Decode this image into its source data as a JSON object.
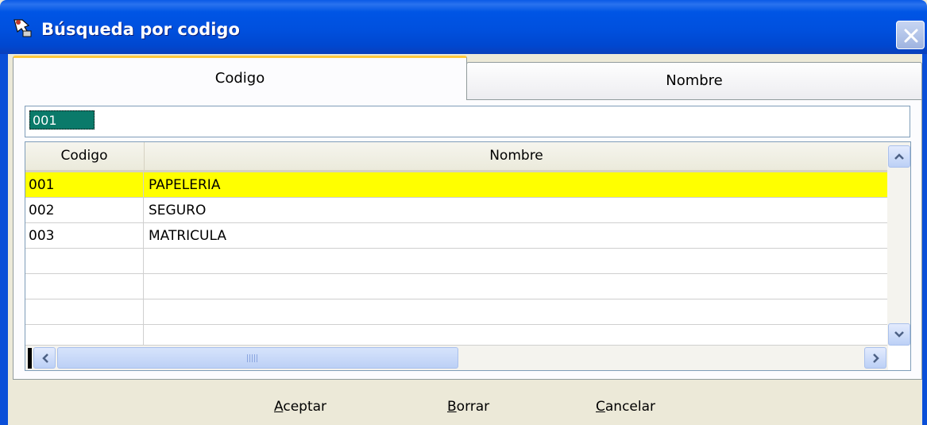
{
  "window": {
    "title": "Búsqueda por codigo"
  },
  "tabs": [
    {
      "label": "Codigo",
      "active": true
    },
    {
      "label": "Nombre",
      "active": false
    }
  ],
  "search": {
    "value": "001"
  },
  "grid": {
    "columns": [
      "Codigo",
      "Nombre"
    ],
    "rows": [
      {
        "codigo": "001",
        "nombre": "PAPELERIA",
        "selected": true
      },
      {
        "codigo": "002",
        "nombre": "SEGURO",
        "selected": false
      },
      {
        "codigo": "003",
        "nombre": "MATRICULA",
        "selected": false
      },
      {
        "codigo": "",
        "nombre": "",
        "selected": false
      },
      {
        "codigo": "",
        "nombre": "",
        "selected": false
      },
      {
        "codigo": "",
        "nombre": "",
        "selected": false
      },
      {
        "codigo": "",
        "nombre": "",
        "selected": false
      }
    ]
  },
  "buttons": {
    "accept": {
      "mnemonic": "A",
      "rest": "ceptar"
    },
    "clear": {
      "mnemonic": "B",
      "rest": "orrar"
    },
    "cancel": {
      "mnemonic": "C",
      "rest": "ancelar"
    }
  },
  "colors": {
    "titlebar": "#0055e5",
    "selected_row": "#ffff00",
    "code_highlight": "#0a7a6a",
    "active_tab_accent": "#ffc83c"
  },
  "icons": {
    "title": "search-pointer-icon",
    "close": "close-icon",
    "scroll_up": "chevron-up-icon",
    "scroll_down": "chevron-down-icon",
    "scroll_left": "chevron-left-icon",
    "scroll_right": "chevron-right-icon"
  }
}
